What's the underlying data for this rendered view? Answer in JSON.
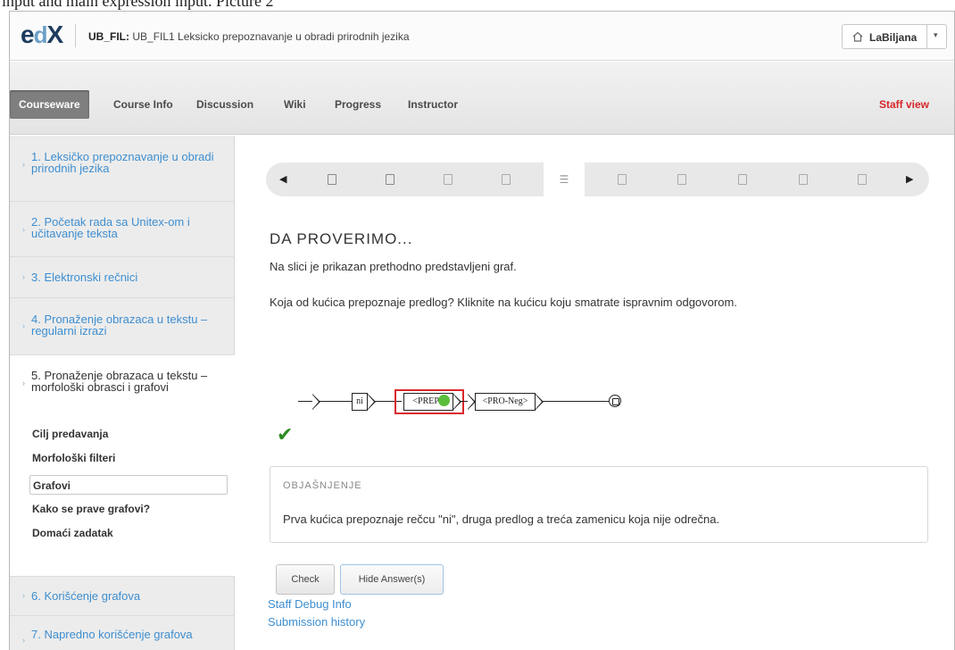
{
  "caption": "input and main expression input. Picture 2",
  "header": {
    "logo": {
      "e": "e",
      "d": "d",
      "x": "X"
    },
    "course_code": "UB_FIL:",
    "course_name": "UB_FIL1 Leksicko prepoznavanje u obradi prirodnih jezika",
    "user": "LaBiljana"
  },
  "nav": {
    "items": [
      "Courseware",
      "Course Info",
      "Discussion",
      "Wiki",
      "Progress",
      "Instructor"
    ],
    "active": "Courseware",
    "staff_view": "Staff view"
  },
  "sidebar": {
    "chapters": [
      {
        "label": "1. Leksičko prepoznavanje u obradi prirodnih jezika"
      },
      {
        "label": "2. Početak rada sa Unitex-om i učitavanje teksta"
      },
      {
        "label": "3. Elektronski rečnici"
      },
      {
        "label": "4. Pronaženje obrazaca u tekstu – regularni izrazi"
      },
      {
        "label": "5. Pronaženje obrazaca u tekstu – morfološki obrasci i grafovi",
        "open": true
      },
      {
        "label": "6. Korišćenje grafova"
      },
      {
        "label": "7. Napredno korišćenje grafova"
      }
    ],
    "subsections": [
      "Cilj predavanja",
      "Morfološki filteri",
      "Grafovi",
      "Kako se prave grafovi?",
      "Domaći zadatak"
    ],
    "active_subsection": "Grafovi"
  },
  "sequence": {
    "units": 10,
    "current_index": 4,
    "current_icon": "list-icon",
    "other_icon": "document-icon"
  },
  "problem": {
    "title": "DA PROVERIMO...",
    "text1": "Na slici je prikazan prethodno predstavljeni graf.",
    "text2": "Koja od kućica prepoznaje predlog? Kliknite na kućicu koju smatrate ispravnim odgovorom.",
    "graph": {
      "box1": "ni",
      "box2": "<PREP>",
      "box3": "<PRO-Neg>"
    },
    "status": "correct"
  },
  "explanation": {
    "heading": "OBJAŠNJENJE",
    "text": "Prva kućica prepoznaje rečcu \"ni\", druga predlog a treća zamenicu koja nije odrečna."
  },
  "buttons": {
    "check": "Check",
    "hide_answer": "Hide Answer(s)"
  },
  "links": {
    "staff_debug": "Staff Debug Info",
    "submission_history": "Submission history"
  },
  "colors": {
    "link": "#3e8ed0",
    "staff_view": "#d7262a",
    "highlight_border": "#d9272d",
    "selection_dot": "#5bbd3c",
    "check": "#2e8b22"
  }
}
